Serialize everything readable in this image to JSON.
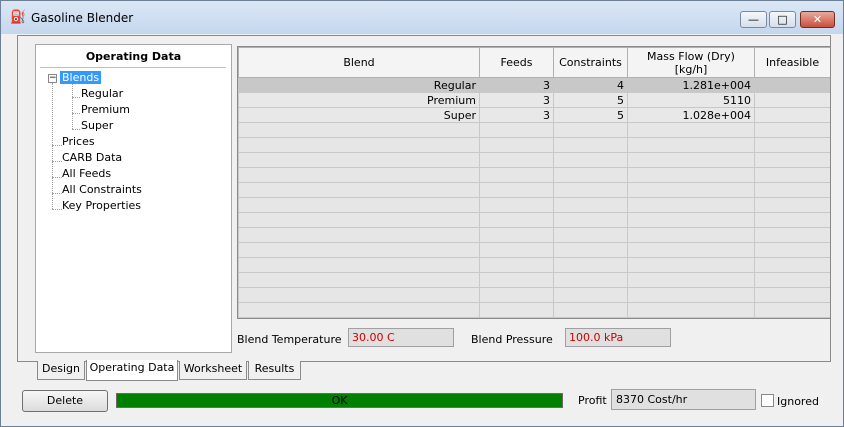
{
  "window": {
    "title": "Gasoline Blender",
    "buttons": {
      "minimize": "—",
      "maximize": "□",
      "close": "✕"
    }
  },
  "tree": {
    "header": "Operating Data",
    "expander": "−",
    "items": [
      {
        "label": "Blends",
        "level": 0,
        "selected": true
      },
      {
        "label": "Regular",
        "level": 1
      },
      {
        "label": "Premium",
        "level": 1
      },
      {
        "label": "Super",
        "level": 1
      },
      {
        "label": "Prices",
        "level": 0
      },
      {
        "label": "CARB Data",
        "level": 0
      },
      {
        "label": "All Feeds",
        "level": 0
      },
      {
        "label": "All Constraints",
        "level": 0
      },
      {
        "label": "Key Properties",
        "level": 0
      }
    ]
  },
  "table": {
    "columns": [
      "Blend",
      "Feeds",
      "Constraints",
      "Mass Flow (Dry)\n[kg/h]",
      "Infeasible"
    ],
    "rows": [
      [
        "Regular",
        "3",
        "4",
        "1.281e+004",
        ""
      ],
      [
        "Premium",
        "3",
        "5",
        "5110",
        ""
      ],
      [
        "Super",
        "3",
        "5",
        "1.028e+004",
        ""
      ]
    ]
  },
  "conditions": {
    "temperature_label": "Blend Temperature",
    "temperature_value": "30.00 C",
    "pressure_label": "Blend Pressure",
    "pressure_value": "100.0 kPa"
  },
  "tabs": [
    {
      "label": "Design",
      "active": false
    },
    {
      "label": "Operating Data",
      "active": true
    },
    {
      "label": "Worksheet",
      "active": false
    },
    {
      "label": "Results",
      "active": false
    }
  ],
  "footer": {
    "delete_label": "Delete",
    "status_text": "OK",
    "status_color": "#008000",
    "profit_label": "Profit",
    "profit_value": "8370 Cost/hr",
    "ignored_label": "Ignored",
    "ignored_checked": false
  }
}
